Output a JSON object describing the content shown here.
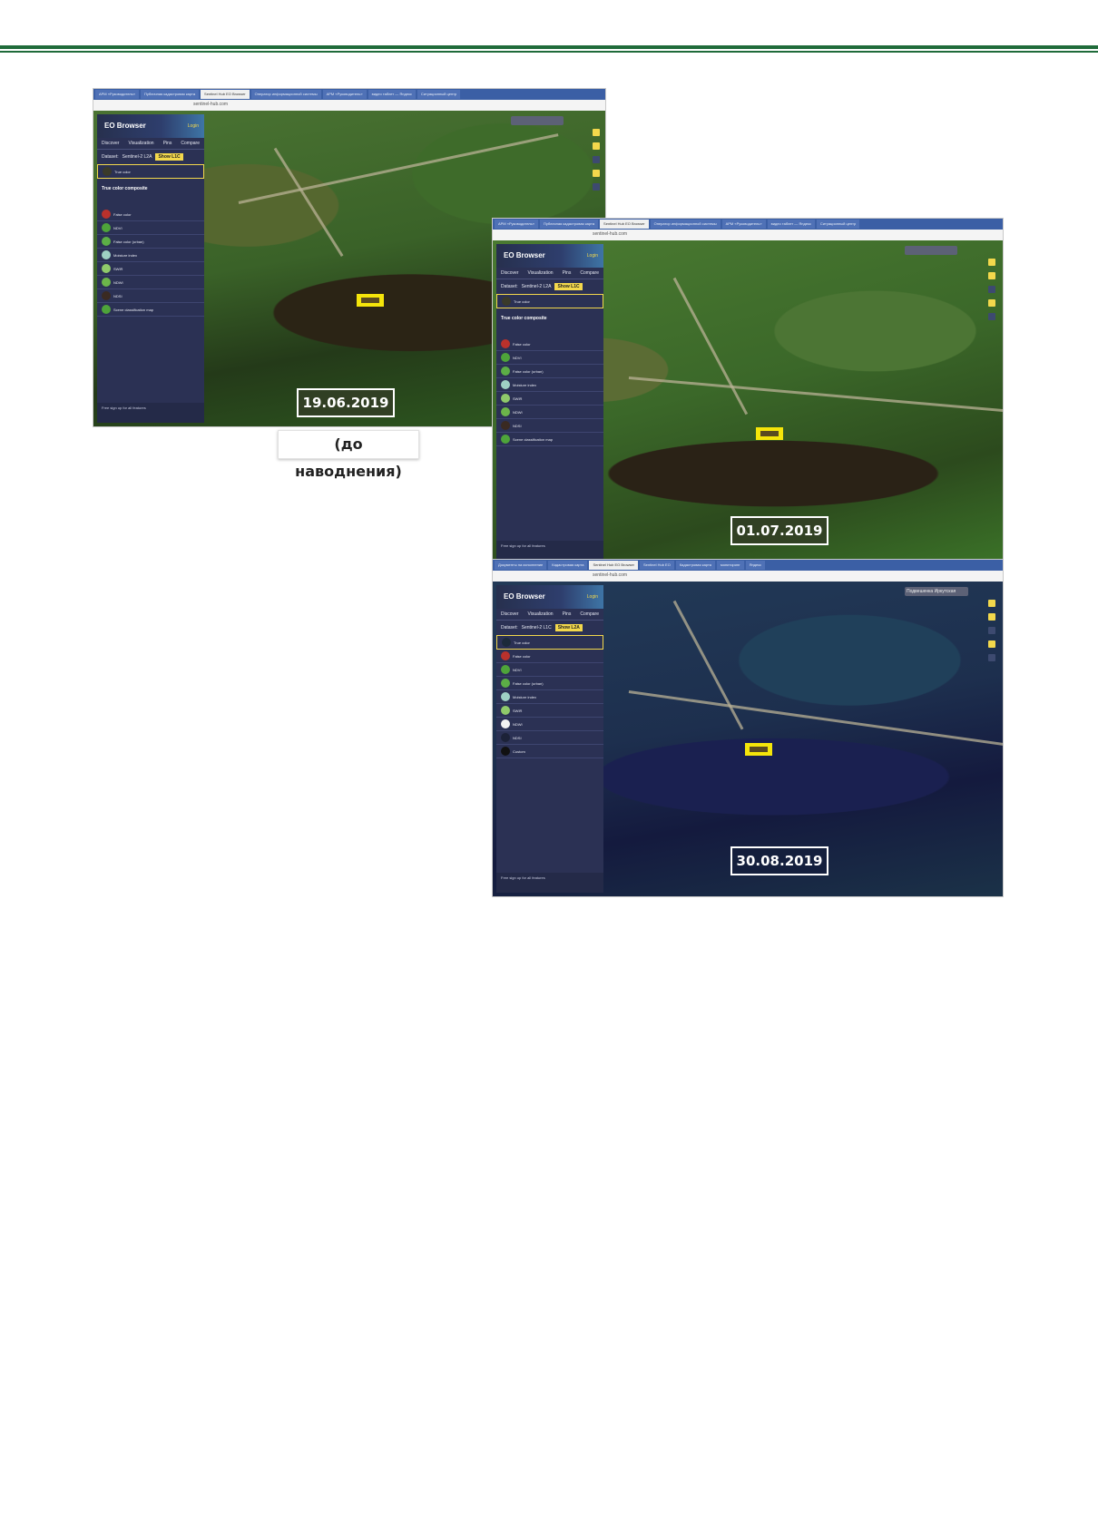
{
  "screenshots": [
    {
      "id": "june",
      "date": "19.06.2019",
      "tabs": [
        "АРМ «Руководитель»",
        "Публичная кадастровая карта",
        "Sentinel Hub EO Browser",
        "Оператор информационной системы",
        "АРМ «Руководитель»",
        "видео таблет — Яндекс",
        "Ситуационный центр"
      ],
      "url": "sentinel-hub.com",
      "brand": "EO Browser",
      "login": "Login",
      "nav": [
        "Discover",
        "Visualization",
        "Pins",
        "Compare"
      ],
      "dataset_label": "Dataset:",
      "dataset_value": "Sentinel-2 L2A",
      "dataset_badge": "Show L1C",
      "layers": [
        "True color",
        "False color",
        "NDVI",
        "False color (urban)",
        "Moisture index",
        "SWIR",
        "NDWI",
        "NDSI",
        "Scene classification map"
      ],
      "composite_title": "True color composite",
      "footer": "Free sign up for all features"
    },
    {
      "id": "july",
      "date": "01.07.2019",
      "tabs": [
        "АРМ «Руководитель»",
        "Публичная кадастровая карта",
        "Sentinel Hub EO Browser",
        "Оператор информационной системы",
        "АРМ «Руководитель»",
        "видео таблет — Яндекс",
        "Ситуационный центр"
      ],
      "url": "sentinel-hub.com",
      "brand": "EO Browser",
      "login": "Login",
      "nav": [
        "Discover",
        "Visualization",
        "Pins",
        "Compare"
      ],
      "dataset_label": "Dataset:",
      "dataset_value": "Sentinel-2 L2A",
      "dataset_badge": "Show L1C",
      "layers": [
        "True color",
        "False color",
        "NDVI",
        "False color (urban)",
        "Moisture index",
        "SWIR",
        "NDWI",
        "NDSI",
        "Scene classification map"
      ],
      "composite_title": "True color composite",
      "footer": "Free sign up for all features"
    },
    {
      "id": "aug",
      "date": "30.08.2019",
      "tabs": [
        "Документы на исполнение",
        "Кадастровая карта",
        "Sentinel Hub EO Browser",
        "Sentinel Hub EO",
        "Кадастровая карта",
        "мониторинг",
        "Яндекс"
      ],
      "url": "sentinel-hub.com",
      "brand": "EO Browser",
      "login": "Login",
      "nav": [
        "Discover",
        "Visualization",
        "Pins",
        "Compare"
      ],
      "dataset_label": "Dataset:",
      "dataset_value": "Sentinel-2 L1C",
      "dataset_badge": "Show L2A",
      "layers": [
        "True color",
        "False color",
        "NDVI",
        "False color (urban)",
        "Moisture index",
        "SWIR",
        "NDWI",
        "NDSI",
        "Custom"
      ],
      "search_value": "Подвешенка Иркутская",
      "footer": "Free sign up for all features"
    }
  ],
  "caption": "(до наводнения)",
  "colors": {
    "rule": "#1f6b3a",
    "marker": "#f5e50a",
    "panel": "#2b3154",
    "accent": "#f3d84c"
  }
}
